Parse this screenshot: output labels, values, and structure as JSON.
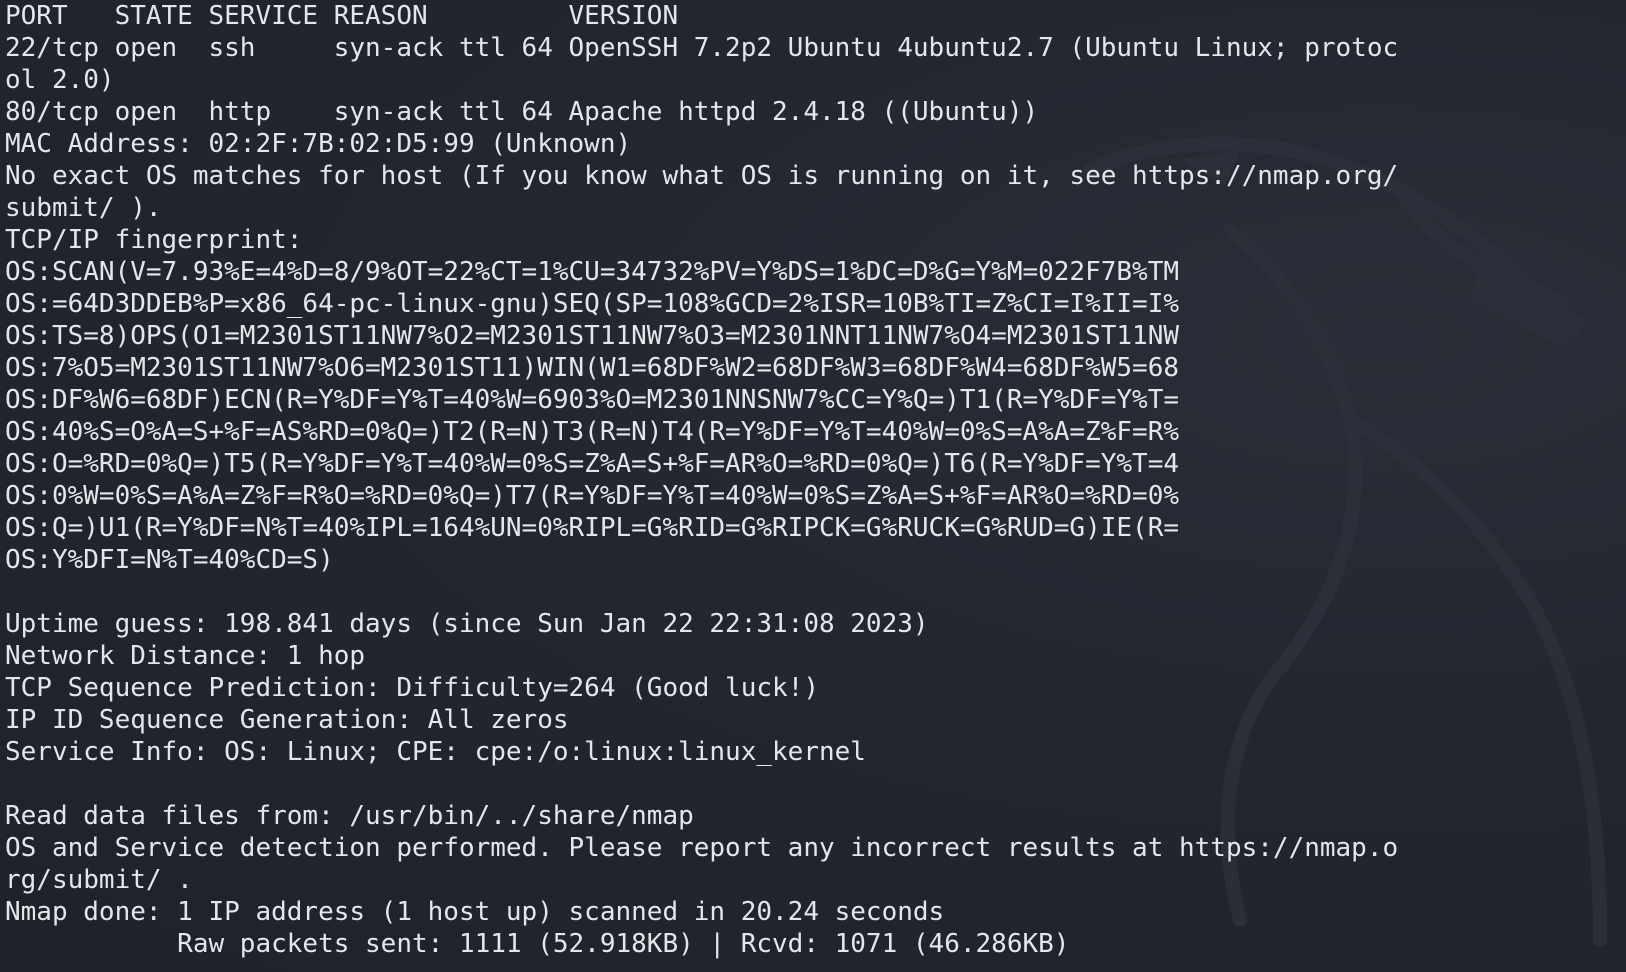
{
  "terminal": {
    "watermark_icon": "kali-dragon-icon",
    "colors": {
      "background": "#23262f",
      "text": "#e4e6ea"
    },
    "lines": [
      "PORT   STATE SERVICE REASON         VERSION",
      "22/tcp open  ssh     syn-ack ttl 64 OpenSSH 7.2p2 Ubuntu 4ubuntu2.7 (Ubuntu Linux; protoc",
      "ol 2.0)",
      "80/tcp open  http    syn-ack ttl 64 Apache httpd 2.4.18 ((Ubuntu))",
      "MAC Address: 02:2F:7B:02:D5:99 (Unknown)",
      "No exact OS matches for host (If you know what OS is running on it, see https://nmap.org/",
      "submit/ ).",
      "TCP/IP fingerprint:",
      "OS:SCAN(V=7.93%E=4%D=8/9%OT=22%CT=1%CU=34732%PV=Y%DS=1%DC=D%G=Y%M=022F7B%TM",
      "OS:=64D3DDEB%P=x86_64-pc-linux-gnu)SEQ(SP=108%GCD=2%ISR=10B%TI=Z%CI=I%II=I%",
      "OS:TS=8)OPS(O1=M2301ST11NW7%O2=M2301ST11NW7%O3=M2301NNT11NW7%O4=M2301ST11NW",
      "OS:7%O5=M2301ST11NW7%O6=M2301ST11)WIN(W1=68DF%W2=68DF%W3=68DF%W4=68DF%W5=68",
      "OS:DF%W6=68DF)ECN(R=Y%DF=Y%T=40%W=6903%O=M2301NNSNW7%CC=Y%Q=)T1(R=Y%DF=Y%T=",
      "OS:40%S=O%A=S+%F=AS%RD=0%Q=)T2(R=N)T3(R=N)T4(R=Y%DF=Y%T=40%W=0%S=A%A=Z%F=R%",
      "OS:O=%RD=0%Q=)T5(R=Y%DF=Y%T=40%W=0%S=Z%A=S+%F=AR%O=%RD=0%Q=)T6(R=Y%DF=Y%T=4",
      "OS:0%W=0%S=A%A=Z%F=R%O=%RD=0%Q=)T7(R=Y%DF=Y%T=40%W=0%S=Z%A=S+%F=AR%O=%RD=0%",
      "OS:Q=)U1(R=Y%DF=N%T=40%IPL=164%UN=0%RIPL=G%RID=G%RIPCK=G%RUCK=G%RUD=G)IE(R=",
      "OS:Y%DFI=N%T=40%CD=S)",
      "",
      "Uptime guess: 198.841 days (since Sun Jan 22 22:31:08 2023)",
      "Network Distance: 1 hop",
      "TCP Sequence Prediction: Difficulty=264 (Good luck!)",
      "IP ID Sequence Generation: All zeros",
      "Service Info: OS: Linux; CPE: cpe:/o:linux:linux_kernel",
      "",
      "Read data files from: /usr/bin/../share/nmap",
      "OS and Service detection performed. Please report any incorrect results at https://nmap.o",
      "rg/submit/ .",
      "Nmap done: 1 IP address (1 host up) scanned in 20.24 seconds",
      "           Raw packets sent: 1111 (52.918KB) | Rcvd: 1071 (46.286KB)"
    ]
  }
}
